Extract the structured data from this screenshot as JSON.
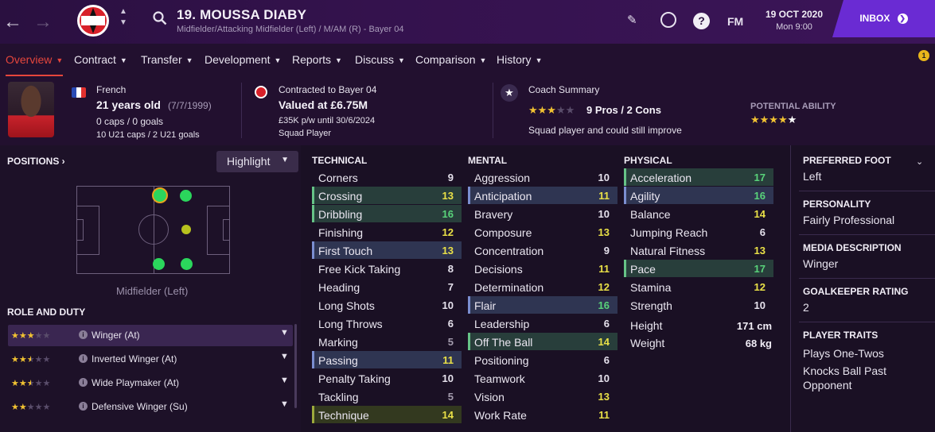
{
  "header": {
    "player_title": "19. MOUSSA DIABY",
    "player_subtitle": "Midfielder/Attacking Midfielder (Left) / M/AM (R) - Bayer 04",
    "fm_label": "FM",
    "date": "19 OCT 2020",
    "time": "Mon 9:00",
    "inbox_label": "INBOX",
    "notification_count": "1"
  },
  "menu": [
    {
      "label": "Overview"
    },
    {
      "label": "Contract"
    },
    {
      "label": "Transfer"
    },
    {
      "label": "Development"
    },
    {
      "label": "Reports"
    },
    {
      "label": "Discuss"
    },
    {
      "label": "Comparison"
    },
    {
      "label": "History"
    }
  ],
  "summary": {
    "nationality": "French",
    "age": "21 years old",
    "dob": "(7/7/1999)",
    "caps": "0 caps / 0 goals",
    "u21": "10 U21 caps / 2 U21 goals",
    "contract_with": "Contracted to Bayer 04",
    "value": "Valued at £6.75M",
    "wage": "£35K p/w until 30/6/2024",
    "squad_status": "Squad Player",
    "coach_summary_label": "Coach Summary",
    "pros_cons": "9 Pros / 2 Cons",
    "coach_note": "Squad player and could still improve",
    "potential_label": "POTENTIAL ABILITY",
    "current_ability_stars": 3,
    "potential_ability_stars": 4.5
  },
  "positions": {
    "label": "POSITIONS",
    "highlight_label": "Highlight",
    "position_caption": "Midfielder (Left)",
    "role_duty_label": "ROLE AND DUTY",
    "roles": [
      {
        "name": "Winger (At)",
        "stars": 3
      },
      {
        "name": "Inverted Winger (At)",
        "stars": 2.5
      },
      {
        "name": "Wide Playmaker (At)",
        "stars": 2.5
      },
      {
        "name": "Defensive Winger (Su)",
        "stars": 2
      }
    ]
  },
  "technical": {
    "label": "TECHNICAL",
    "attributes": [
      {
        "name": "Corners",
        "value": "9"
      },
      {
        "name": "Crossing",
        "value": "13"
      },
      {
        "name": "Dribbling",
        "value": "16"
      },
      {
        "name": "Finishing",
        "value": "12"
      },
      {
        "name": "First Touch",
        "value": "13"
      },
      {
        "name": "Free Kick Taking",
        "value": "8"
      },
      {
        "name": "Heading",
        "value": "7"
      },
      {
        "name": "Long Shots",
        "value": "10"
      },
      {
        "name": "Long Throws",
        "value": "6"
      },
      {
        "name": "Marking",
        "value": "5"
      },
      {
        "name": "Passing",
        "value": "11"
      },
      {
        "name": "Penalty Taking",
        "value": "10"
      },
      {
        "name": "Tackling",
        "value": "5"
      },
      {
        "name": "Technique",
        "value": "14"
      }
    ]
  },
  "mental": {
    "label": "MENTAL",
    "attributes": [
      {
        "name": "Aggression",
        "value": "10"
      },
      {
        "name": "Anticipation",
        "value": "11"
      },
      {
        "name": "Bravery",
        "value": "10"
      },
      {
        "name": "Composure",
        "value": "13"
      },
      {
        "name": "Concentration",
        "value": "9"
      },
      {
        "name": "Decisions",
        "value": "11"
      },
      {
        "name": "Determination",
        "value": "12"
      },
      {
        "name": "Flair",
        "value": "16"
      },
      {
        "name": "Leadership",
        "value": "6"
      },
      {
        "name": "Off The Ball",
        "value": "14"
      },
      {
        "name": "Positioning",
        "value": "6"
      },
      {
        "name": "Teamwork",
        "value": "10"
      },
      {
        "name": "Vision",
        "value": "13"
      },
      {
        "name": "Work Rate",
        "value": "11"
      }
    ]
  },
  "physical": {
    "label": "PHYSICAL",
    "attributes": [
      {
        "name": "Acceleration",
        "value": "17"
      },
      {
        "name": "Agility",
        "value": "16"
      },
      {
        "name": "Balance",
        "value": "14"
      },
      {
        "name": "Jumping Reach",
        "value": "6"
      },
      {
        "name": "Natural Fitness",
        "value": "13"
      },
      {
        "name": "Pace",
        "value": "17"
      },
      {
        "name": "Stamina",
        "value": "12"
      },
      {
        "name": "Strength",
        "value": "10"
      }
    ],
    "height_label": "Height",
    "height_value": "171 cm",
    "weight_label": "Weight",
    "weight_value": "68 kg"
  },
  "details": {
    "preferred_foot_label": "PREFERRED FOOT",
    "preferred_foot": "Left",
    "personality_label": "PERSONALITY",
    "personality": "Fairly Professional",
    "media_label": "MEDIA DESCRIPTION",
    "media": "Winger",
    "gk_label": "GOALKEEPER RATING",
    "gk": "2",
    "traits_label": "PLAYER TRAITS",
    "trait_1": "Plays One-Twos",
    "trait_2": "Knocks Ball Past",
    "trait_3": "Opponent"
  },
  "colors": {
    "accent_red": "#e5463c",
    "inbox_purple": "#6a2bd3",
    "value_green": "#59d37a",
    "value_yellow": "#e9e047",
    "star_gold": "#f1c232"
  }
}
